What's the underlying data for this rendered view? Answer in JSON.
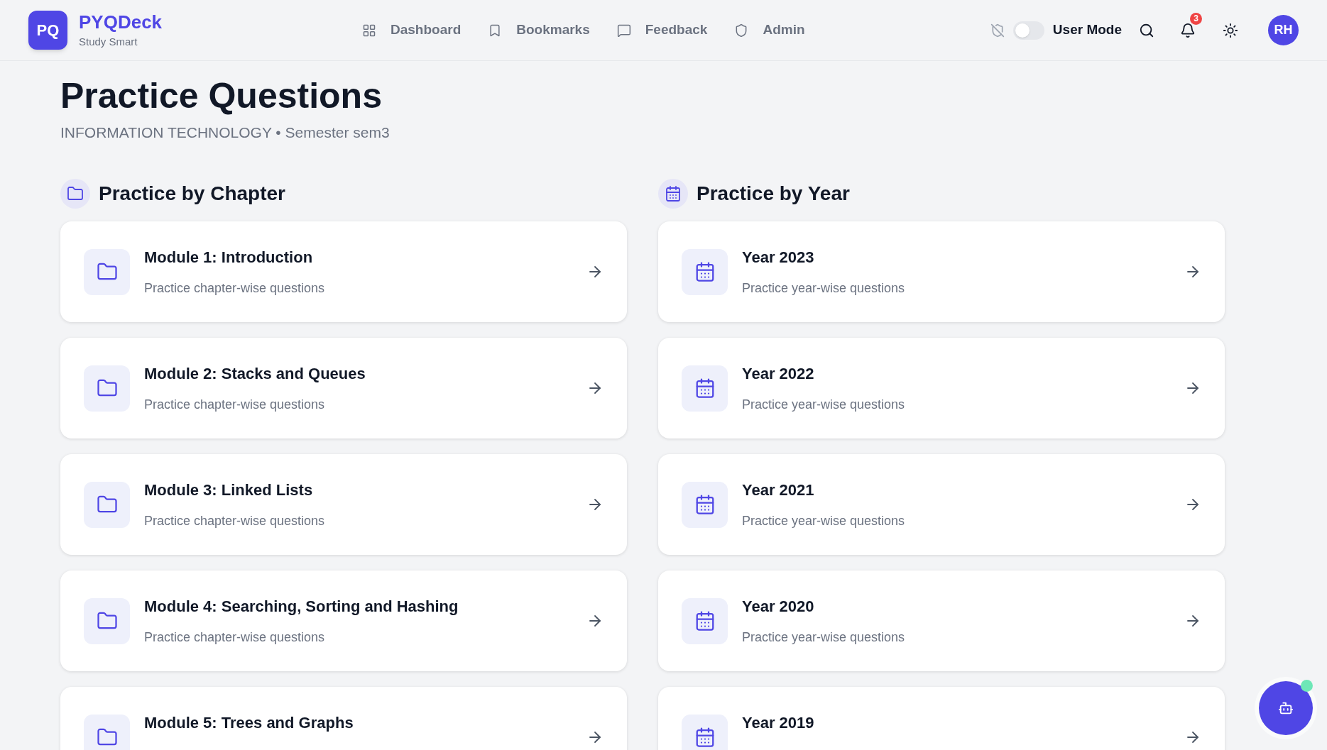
{
  "brand": {
    "logo": "PQ",
    "name": "PYQDeck",
    "tagline": "Study Smart"
  },
  "nav": [
    {
      "label": "Dashboard",
      "kind": "grid"
    },
    {
      "label": "Bookmarks",
      "kind": "bookmark"
    },
    {
      "label": "Feedback",
      "kind": "message"
    },
    {
      "label": "Admin",
      "kind": "shield"
    }
  ],
  "mode_toggle": {
    "label": "User Mode",
    "on": false
  },
  "notifications": {
    "count": "3"
  },
  "avatar": "RH",
  "page": {
    "title": "Practice Questions",
    "subtitle": "INFORMATION TECHNOLOGY • Semester sem3"
  },
  "sections": [
    {
      "kind": "chapter",
      "title": "Practice by Chapter",
      "items": [
        {
          "title": "Module 1: Introduction",
          "subtitle": "Practice chapter-wise questions"
        },
        {
          "title": "Module 2: Stacks and Queues",
          "subtitle": "Practice chapter-wise questions"
        },
        {
          "title": "Module 3: Linked Lists",
          "subtitle": "Practice chapter-wise questions"
        },
        {
          "title": "Module 4: Searching, Sorting and Hashing",
          "subtitle": "Practice chapter-wise questions"
        },
        {
          "title": "Module 5: Trees and Graphs"
        }
      ]
    },
    {
      "kind": "year",
      "title": "Practice by Year",
      "items": [
        {
          "title": "Year 2023",
          "subtitle": "Practice year-wise questions"
        },
        {
          "title": "Year 2022",
          "subtitle": "Practice year-wise questions"
        },
        {
          "title": "Year 2021",
          "subtitle": "Practice year-wise questions"
        },
        {
          "title": "Year 2020",
          "subtitle": "Practice year-wise questions"
        },
        {
          "title": "Year 2019"
        }
      ]
    }
  ]
}
